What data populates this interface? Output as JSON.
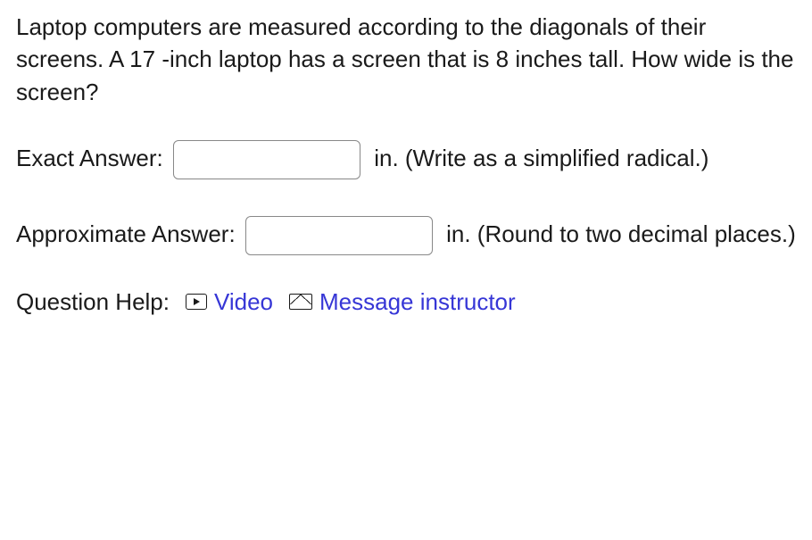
{
  "problem_text": "Laptop computers are measured according to the diagonals of their screens. A 17 -inch laptop has a screen that is 8 inches tall. How wide is the screen?",
  "exact": {
    "label_before": "Exact Answer: ",
    "unit_and_hint": " in. (Write as a simplified radical.)",
    "value": ""
  },
  "approx": {
    "label_before": "Approximate Answer: ",
    "unit_and_hint": " in. (Round to two decimal places.)",
    "value": ""
  },
  "help": {
    "label": "Question Help:",
    "video": "Video",
    "message": "Message instructor"
  }
}
